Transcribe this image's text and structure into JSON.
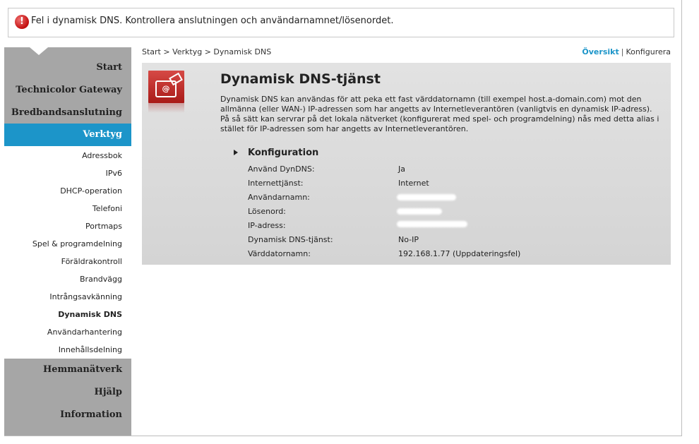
{
  "error": {
    "icon": "error-exclamation-icon",
    "message": "Fel i dynamisk DNS. Kontrollera anslutningen och användarnamnet/lösenordet."
  },
  "sidebar": {
    "main_top": [
      "Start",
      "Technicolor Gateway",
      "Bredbandsanslutning"
    ],
    "active": "Verktyg",
    "sub_items": [
      "Adressbok",
      "IPv6",
      "DHCP-operation",
      "Telefoni",
      "Portmaps",
      "Spel & programdelning",
      "Föräldrakontroll",
      "Brandvägg",
      "Intrångsavkänning",
      "Dynamisk DNS",
      "Användarhantering",
      "Innehållsdelning"
    ],
    "current_sub": "Dynamisk DNS",
    "main_bottom": [
      "Hemmanätverk",
      "Hjälp",
      "Information"
    ]
  },
  "breadcrumb": "Start > Verktyg > Dynamisk DNS",
  "view_links": {
    "overview": "Översikt",
    "separator": "|",
    "configure": "Konfigurera"
  },
  "panel": {
    "icon": "dynamic-dns-service-icon",
    "title": "Dynamisk DNS-tjänst",
    "description": "Dynamisk DNS kan användas för att peka ett fast värddatornamn (till exempel host.a-domain.com) mot den allmänna (eller WAN-) IP-adressen som har angetts av Internetleverantören (vanligtvis en dynamisk IP-adress). På så sätt kan servrar på det lokala nätverket (konfigurerat med spel- och programdelning) nås med detta alias i stället för IP-adressen som har angetts av Internetleverantören.",
    "config_heading": "Konfiguration",
    "rows": [
      {
        "label": "Använd DynDNS:",
        "value": "Ja"
      },
      {
        "label": "Internettjänst:",
        "value": "Internet"
      },
      {
        "label": "Användarnamn:",
        "value": ""
      },
      {
        "label": "Lösenord:",
        "value": ""
      },
      {
        "label": "IP-adress:",
        "value": ""
      },
      {
        "label": "Dynamisk DNS-tjänst:",
        "value": "No-IP"
      },
      {
        "label": "Värddatornamn:",
        "value": "192.168.1.77 (Uppdateringsfel)"
      }
    ]
  },
  "colors": {
    "accent": "#1c95c9",
    "sidebar_gray": "#a6a6a6",
    "error_red": "#c20f0f",
    "icon_red": "#c2302c"
  }
}
